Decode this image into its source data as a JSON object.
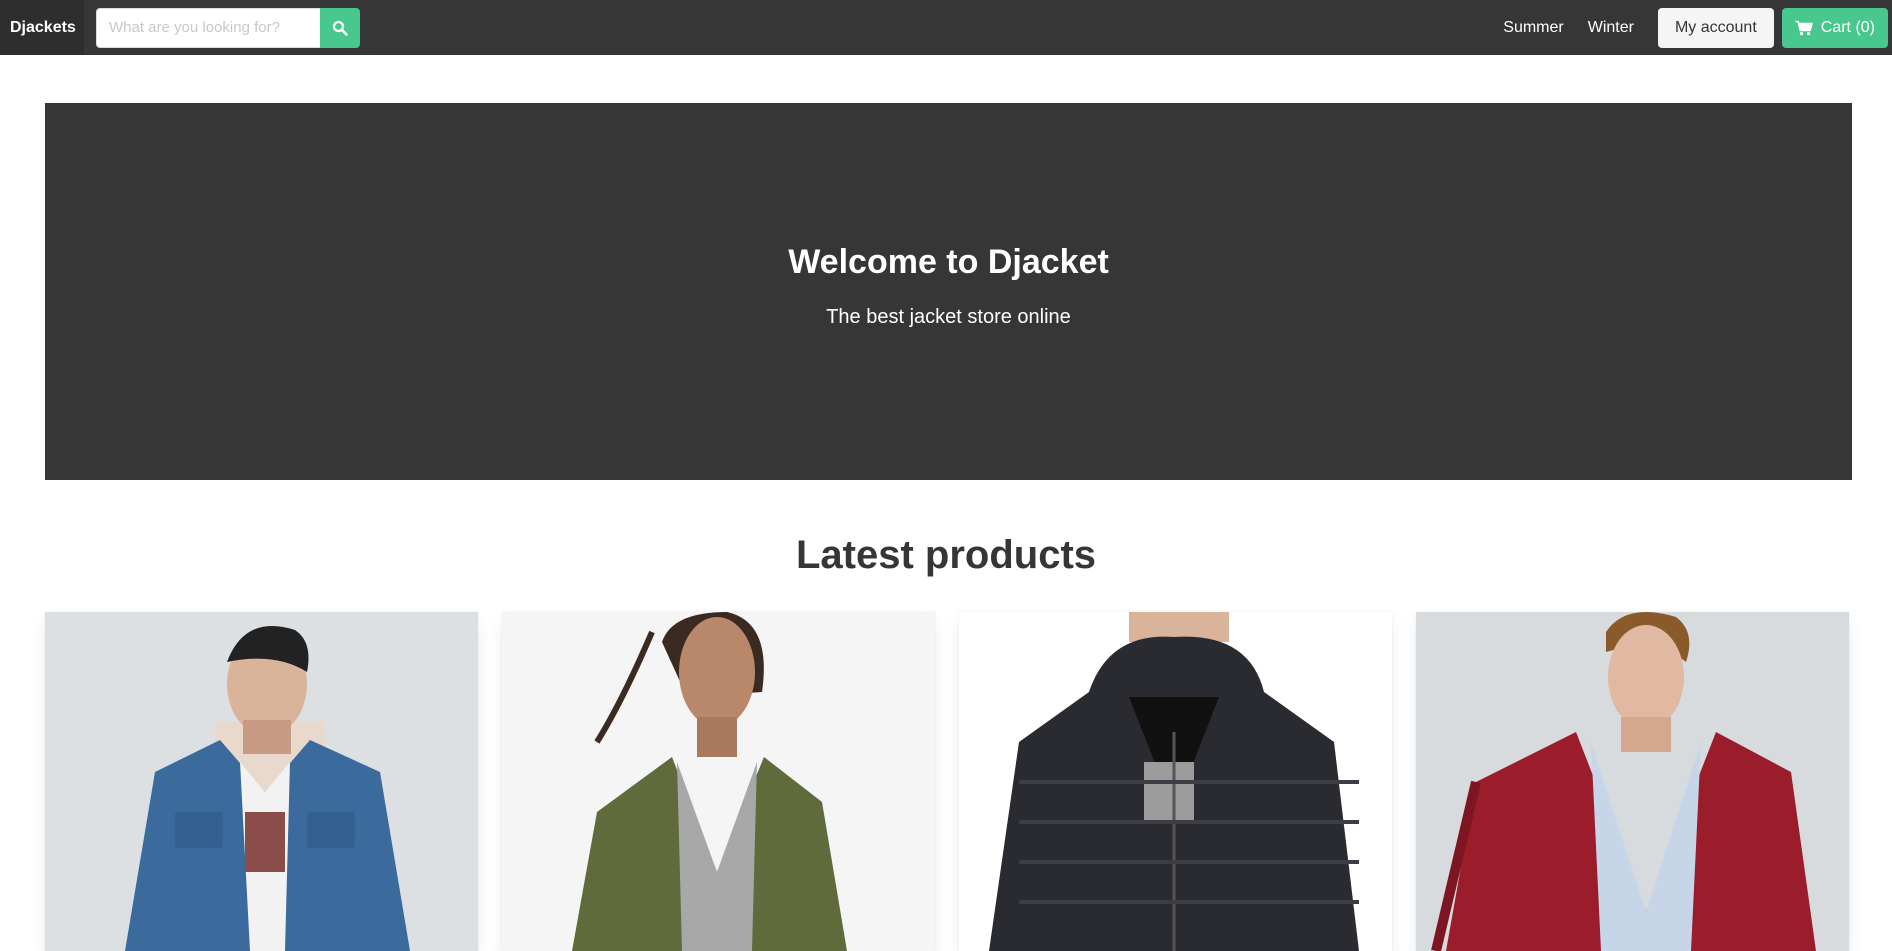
{
  "navbar": {
    "brand": "Djackets",
    "search": {
      "placeholder": "What are you looking for?",
      "value": "",
      "button_icon": "search-icon"
    },
    "links": [
      {
        "label": "Summer"
      },
      {
        "label": "Winter"
      }
    ],
    "account_button": "My account",
    "cart_button": {
      "icon": "cart-icon",
      "label": "Cart (0)"
    }
  },
  "hero": {
    "title": "Welcome to Djacket",
    "subtitle": "The best jacket store online"
  },
  "latest": {
    "title": "Latest products",
    "products": [
      {
        "image": "man-denim-jacket",
        "jacket_color": "#3b6a9c"
      },
      {
        "image": "woman-olive-bomber",
        "jacket_color": "#5f6b3a"
      },
      {
        "image": "black-puffer-jacket",
        "jacket_color": "#2a2a31"
      },
      {
        "image": "man-red-bomber",
        "jacket_color": "#9b1c2a"
      }
    ]
  },
  "colors": {
    "primary_green": "#48c78e",
    "dark": "#363636"
  }
}
